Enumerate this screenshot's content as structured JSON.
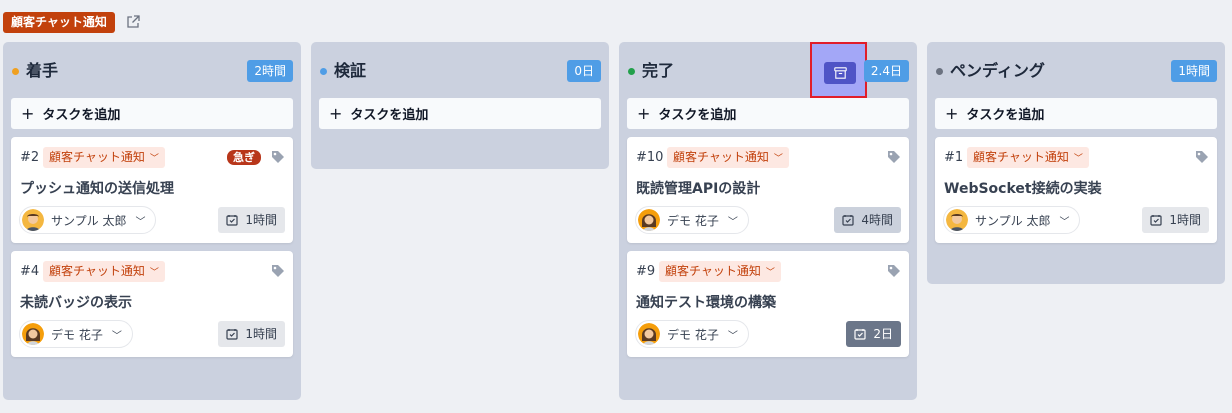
{
  "header": {
    "project_label": "顧客チャット通知"
  },
  "add_task_label": "タスクを追加",
  "columns": [
    {
      "title": "着手",
      "dot_color": "#f0a020",
      "badge": "2時間",
      "cards": [
        {
          "num": "#2",
          "project": "顧客チャット通知",
          "urgent": "急ぎ",
          "title": "プッシュ通知の送信処理",
          "assignee": "サンプル 太郎",
          "estimate": "1時間"
        },
        {
          "num": "#4",
          "project": "顧客チャット通知",
          "title": "未読バッジの表示",
          "assignee": "デモ 花子",
          "estimate": "1時間"
        }
      ]
    },
    {
      "title": "検証",
      "dot_color": "#4f9de6",
      "badge": "0日",
      "cards": []
    },
    {
      "title": "完了",
      "dot_color": "#22a04b",
      "badge": "2.4日",
      "cards": [
        {
          "num": "#10",
          "project": "顧客チャット通知",
          "title": "既読管理APIの設計",
          "assignee": "デモ 花子",
          "estimate": "4時間"
        },
        {
          "num": "#9",
          "project": "顧客チャット通知",
          "title": "通知テスト環境の構築",
          "assignee": "デモ 花子",
          "estimate": "2日"
        }
      ]
    },
    {
      "title": "ペンディング",
      "dot_color": "#6b7280",
      "badge": "1時間",
      "cards": [
        {
          "num": "#1",
          "project": "顧客チャット通知",
          "title": "WebSocket接続の実装",
          "assignee": "サンプル 太郎",
          "estimate": "1時間"
        }
      ]
    }
  ]
}
